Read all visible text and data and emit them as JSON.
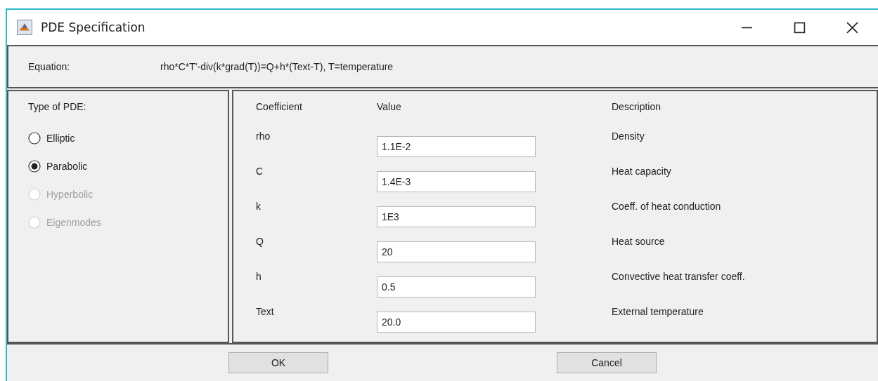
{
  "window": {
    "title": "PDE Specification"
  },
  "equation": {
    "label": "Equation:",
    "value": "rho*C*T'-div(k*grad(T))=Q+h*(Text-T), T=temperature"
  },
  "pde_type": {
    "label": "Type of PDE:",
    "options": [
      {
        "label": "Elliptic",
        "selected": false,
        "disabled": false
      },
      {
        "label": "Parabolic",
        "selected": true,
        "disabled": false
      },
      {
        "label": "Hyperbolic",
        "selected": false,
        "disabled": true
      },
      {
        "label": "Eigenmodes",
        "selected": false,
        "disabled": true
      }
    ]
  },
  "table": {
    "columns": [
      "Coefficient",
      "Value",
      "Description"
    ],
    "rows": [
      {
        "coefficient": "rho",
        "value": "1.1E-2",
        "description": "Density"
      },
      {
        "coefficient": "C",
        "value": "1.4E-3",
        "description": "Heat capacity"
      },
      {
        "coefficient": "k",
        "value": "1E3",
        "description": "Coeff. of heat conduction"
      },
      {
        "coefficient": "Q",
        "value": "20",
        "description": "Heat source"
      },
      {
        "coefficient": "h",
        "value": "0.5",
        "description": "Convective heat transfer coeff."
      },
      {
        "coefficient": "Text",
        "value": "20.0",
        "description": "External temperature"
      }
    ]
  },
  "buttons": [
    "OK",
    "Cancel"
  ]
}
